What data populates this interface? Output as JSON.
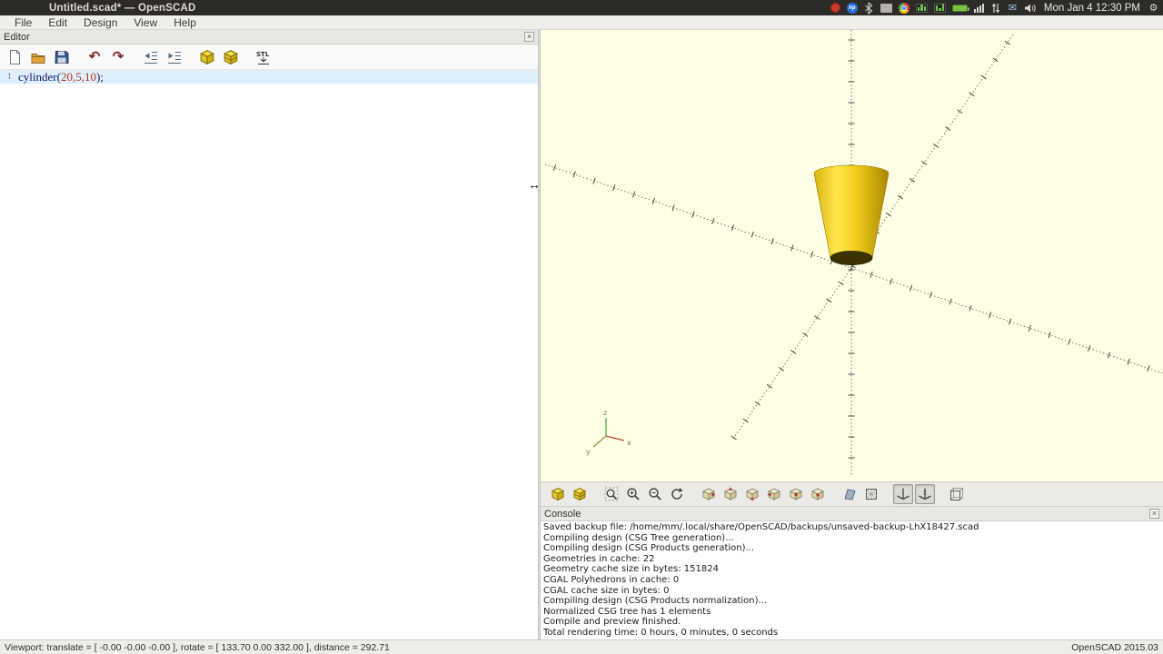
{
  "panel": {
    "title": "Untitled.scad* — OpenSCAD",
    "clock": "Mon Jan 4 12:30 PM"
  },
  "menubar": {
    "items": [
      "File",
      "Edit",
      "Design",
      "View",
      "Help"
    ]
  },
  "editor": {
    "panel_title": "Editor",
    "close_label": "×",
    "line_number": "1",
    "code": {
      "keyword": "cylinder",
      "paren_open": "(",
      "args": "20,5,10",
      "paren_close": ");"
    },
    "stl_label": "STL"
  },
  "viewport": {
    "axis_labels": {
      "x": "x",
      "y": "y",
      "z": "z"
    }
  },
  "console": {
    "panel_title": "Console",
    "close_label": "×",
    "lines": [
      "Saved backup file: /home/mm/.local/share/OpenSCAD/backups/unsaved-backup-LhX18427.scad",
      "Compiling design (CSG Tree generation)...",
      "Compiling design (CSG Products generation)...",
      "Geometries in cache: 22",
      "Geometry cache size in bytes: 151824",
      "CGAL Polyhedrons in cache: 0",
      "CGAL cache size in bytes: 0",
      "Compiling design (CSG Products normalization)...",
      "Normalized CSG tree has 1 elements",
      "Compile and preview finished.",
      "Total rendering time: 0 hours, 0 minutes, 0 seconds"
    ]
  },
  "statusbar": {
    "left": "Viewport: translate = [ -0.00 -0.00 -0.00 ], rotate = [ 133.70 0.00 332.00 ], distance = 292.71",
    "right": "OpenSCAD 2015.03"
  },
  "glyphs": {
    "undo": "↶",
    "redo": "↷",
    "cursor": "↔",
    "mail": "✉",
    "gear": "⚙"
  },
  "colors": {
    "viewport_bg": "#FFFFE5",
    "cone_yellow": "#F3CF1C",
    "panel_bg": "#2C2B28"
  }
}
